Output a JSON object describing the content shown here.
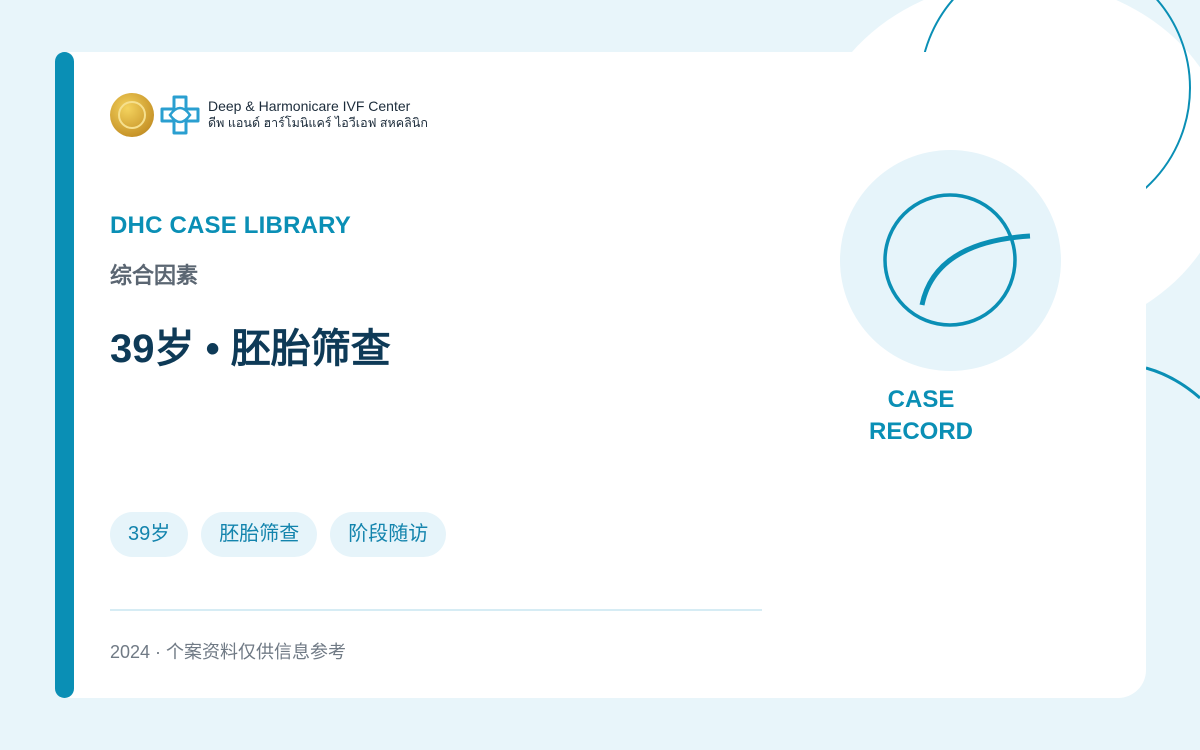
{
  "logo": {
    "name_en": "Deep & Harmonicare IVF Center",
    "name_th": "ดีพ แอนด์ ฮาร์โมนิแคร์ ไอวีเอฟ สหคลินิก",
    "seal_icon": "gold-seal-icon",
    "mark_icon": "blue-cross-icon"
  },
  "header": {
    "kicker": "DHC CASE LIBRARY",
    "category": "综合因素",
    "title": "39岁 • 胚胎筛查"
  },
  "tags": [
    "39岁",
    "胚胎筛查",
    "阶段随访"
  ],
  "footer": {
    "note": "2024 · 个案资料仅供信息参考"
  },
  "badge": {
    "line1": "CASE",
    "line2": "RECORD",
    "icon": "arc-circle-icon"
  },
  "colors": {
    "accent": "#0a8fb5",
    "title": "#0e3a57",
    "tag_bg": "#e6f4fa",
    "background": "#e8f5fa"
  }
}
